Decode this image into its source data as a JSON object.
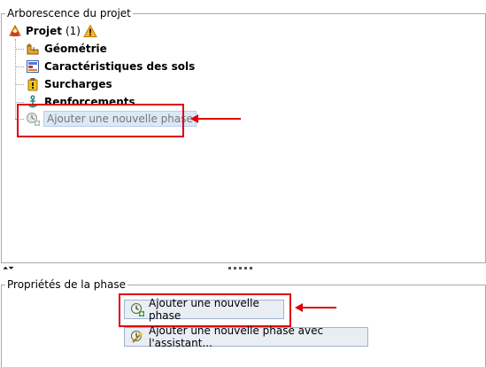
{
  "tree_panel": {
    "title": "Arborescence du projet",
    "root": {
      "label": "Projet",
      "count": "(1)",
      "icon": "project-icon",
      "warning_icon": "warning-icon"
    },
    "items": [
      {
        "label": "Géométrie",
        "icon": "geometry-icon"
      },
      {
        "label": "Caractéristiques des sols",
        "icon": "soil-properties-icon"
      },
      {
        "label": "Surcharges",
        "icon": "surcharge-icon"
      },
      {
        "label": "Renforcements",
        "icon": "anchor-icon"
      }
    ],
    "add_phase": {
      "label": "Ajouter une nouvelle phase",
      "icon": "add-phase-icon"
    }
  },
  "splitter": {
    "arrows": "⏶⏷"
  },
  "properties_panel": {
    "title": "Propriétés de la phase",
    "add_phase_button": "Ajouter une nouvelle phase",
    "add_phase_wizard_button": "Ajouter une nouvelle phase avec l'assistant..."
  },
  "colors": {
    "highlight": "#e0000f",
    "selection": "#dce8f5"
  }
}
